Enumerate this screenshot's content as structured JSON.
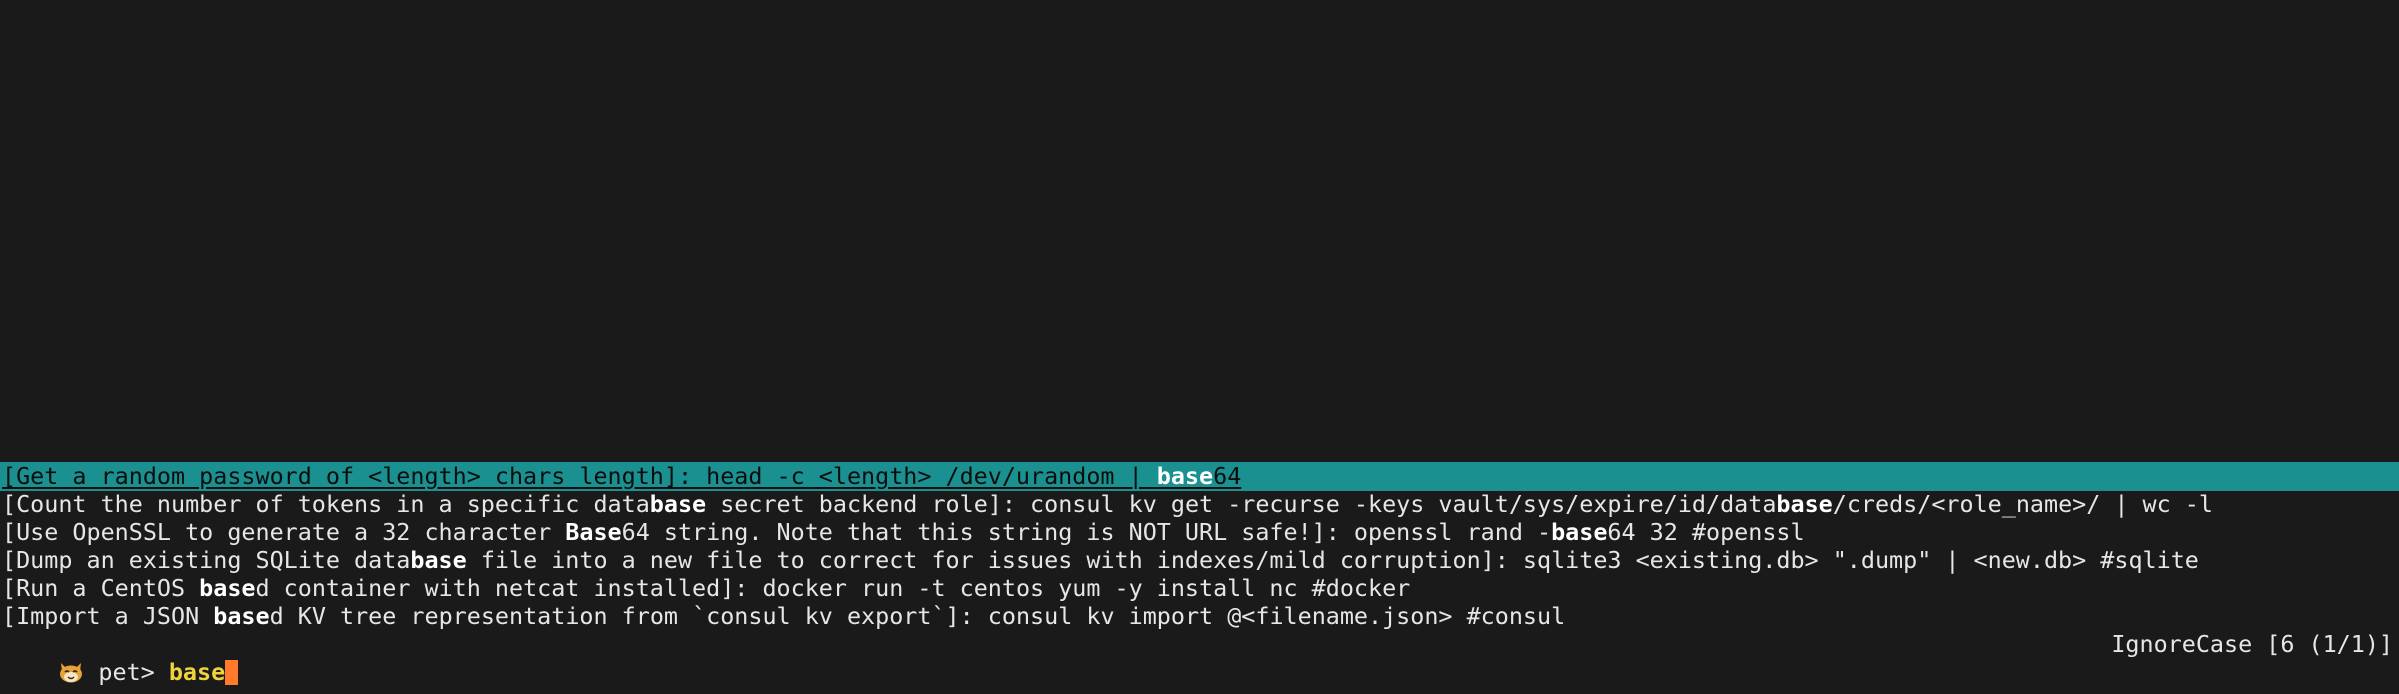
{
  "results": [
    {
      "selected": true,
      "segments": [
        {
          "text": "[Get a random password of <length> chars length]: head -c <length> /dev/urandom | ",
          "match": false
        },
        {
          "text": "base",
          "match": true
        },
        {
          "text": "64",
          "match": false
        }
      ]
    },
    {
      "selected": false,
      "segments": [
        {
          "text": "[Count the number of tokens in a specific data",
          "match": false
        },
        {
          "text": "base",
          "match": true
        },
        {
          "text": " secret backend role]: consul kv get -recurse -keys vault/sys/expire/id/data",
          "match": false
        },
        {
          "text": "base",
          "match": true
        },
        {
          "text": "/creds/<role_name>/ | wc -l",
          "match": false
        }
      ]
    },
    {
      "selected": false,
      "segments": [
        {
          "text": "[Use OpenSSL to generate a 32 character ",
          "match": false
        },
        {
          "text": "Base",
          "match": true
        },
        {
          "text": "64 string. Note that this string is NOT URL safe!]: openssl rand -",
          "match": false
        },
        {
          "text": "base",
          "match": true
        },
        {
          "text": "64 32 #openssl",
          "match": false
        }
      ]
    },
    {
      "selected": false,
      "segments": [
        {
          "text": "[Dump an existing SQLite data",
          "match": false
        },
        {
          "text": "base",
          "match": true
        },
        {
          "text": " file into a new file to correct for issues with indexes/mild corruption]: sqlite3 <existing.db> \".dump\" | <new.db> #sqlite",
          "match": false
        }
      ]
    },
    {
      "selected": false,
      "segments": [
        {
          "text": "[Run a CentOS ",
          "match": false
        },
        {
          "text": "base",
          "match": true
        },
        {
          "text": "d container with netcat installed]: docker run -t centos yum -y install nc #docker",
          "match": false
        }
      ]
    },
    {
      "selected": false,
      "segments": [
        {
          "text": "[Import a JSON ",
          "match": false
        },
        {
          "text": "base",
          "match": true
        },
        {
          "text": "d KV tree representation from `consul kv export`]: consul kv import @<filename.json> #consul",
          "match": false
        }
      ]
    }
  ],
  "prompt": {
    "icon": "cat-face-icon",
    "label": " pet> ",
    "query": "base"
  },
  "status": {
    "text": "IgnoreCase [6 (1/1)]"
  },
  "colors": {
    "background": "#1a1a1a",
    "selection": "#1a9090",
    "query": "#f0d23c",
    "cursor": "#ff7a2a"
  }
}
